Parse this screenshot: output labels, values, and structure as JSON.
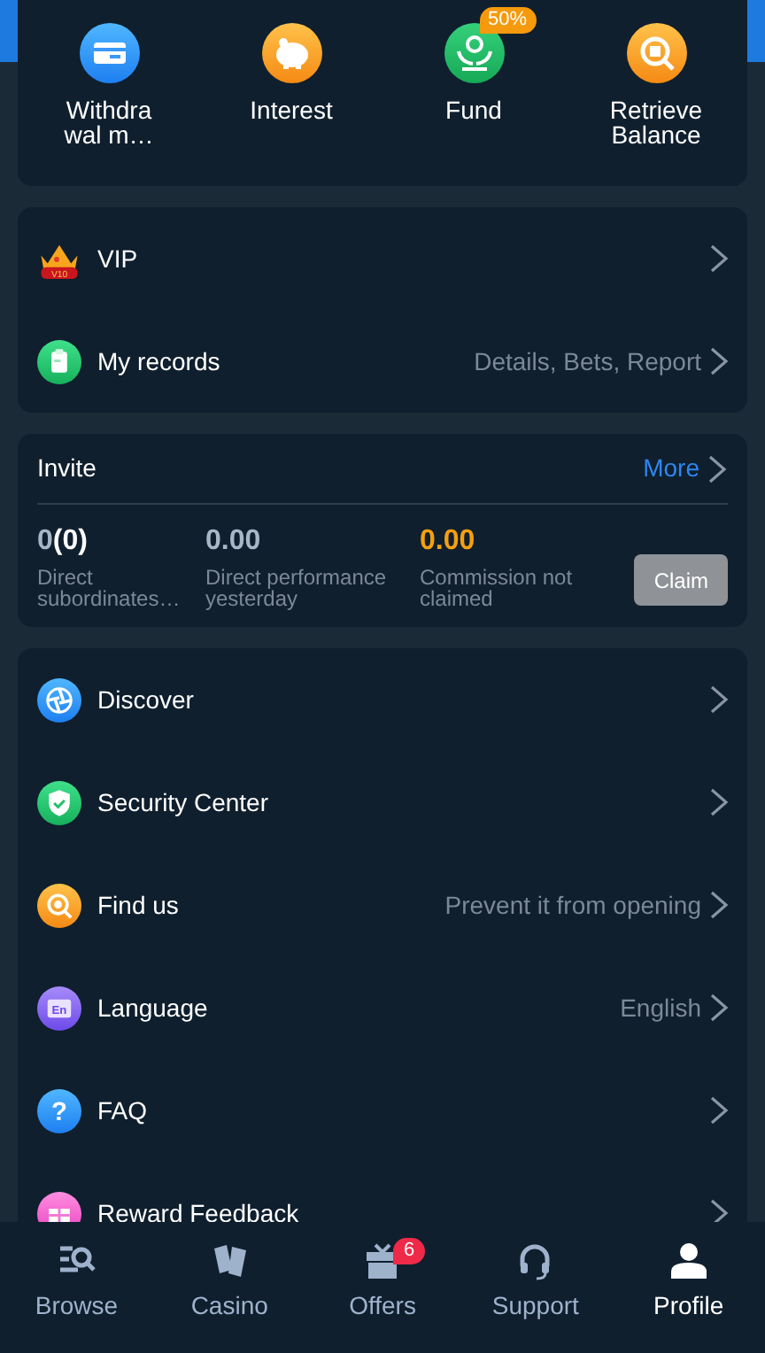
{
  "quick_actions": [
    {
      "kind": "card",
      "label": "Withdra wal m…"
    },
    {
      "kind": "piggy",
      "label": "Interest"
    },
    {
      "kind": "fund",
      "label": "Fund",
      "badge": "50%"
    },
    {
      "kind": "search",
      "label": "Retrieve Balance"
    }
  ],
  "menu_top": [
    {
      "kind": "vip",
      "label": "VIP",
      "icon_text": "V10"
    },
    {
      "kind": "records",
      "label": "My records",
      "detail": "Details, Bets, Report"
    }
  ],
  "invite": {
    "title": "Invite",
    "more": "More",
    "stats": [
      {
        "value": "0",
        "extra": "(0)",
        "label": "Direct subordinates…",
        "kind": "plain"
      },
      {
        "value": "0.00",
        "label": "Direct performance yesterday",
        "kind": "plain"
      },
      {
        "value": "0.00",
        "label": "Commission not claimed",
        "kind": "accent"
      }
    ],
    "claim": {
      "label": "Claim",
      "disabled": true
    }
  },
  "menu_bottom": [
    {
      "kind": "discover",
      "label": "Discover"
    },
    {
      "kind": "security",
      "label": "Security Center"
    },
    {
      "kind": "find",
      "label": "Find us",
      "detail": "Prevent it from opening"
    },
    {
      "kind": "language",
      "label": "Language",
      "detail": "English",
      "icon_text": "En"
    },
    {
      "kind": "faq",
      "label": "FAQ",
      "icon_text": "?"
    },
    {
      "kind": "gift",
      "label": "Reward Feedback"
    }
  ],
  "bottom_nav": [
    {
      "kind": "browse",
      "label": "Browse",
      "selected": false
    },
    {
      "kind": "casino",
      "label": "Casino",
      "selected": false
    },
    {
      "kind": "offers",
      "label": "Offers",
      "selected": false,
      "badge": "6"
    },
    {
      "kind": "support",
      "label": "Support",
      "selected": false
    },
    {
      "kind": "profile",
      "label": "Profile",
      "selected": true
    }
  ]
}
